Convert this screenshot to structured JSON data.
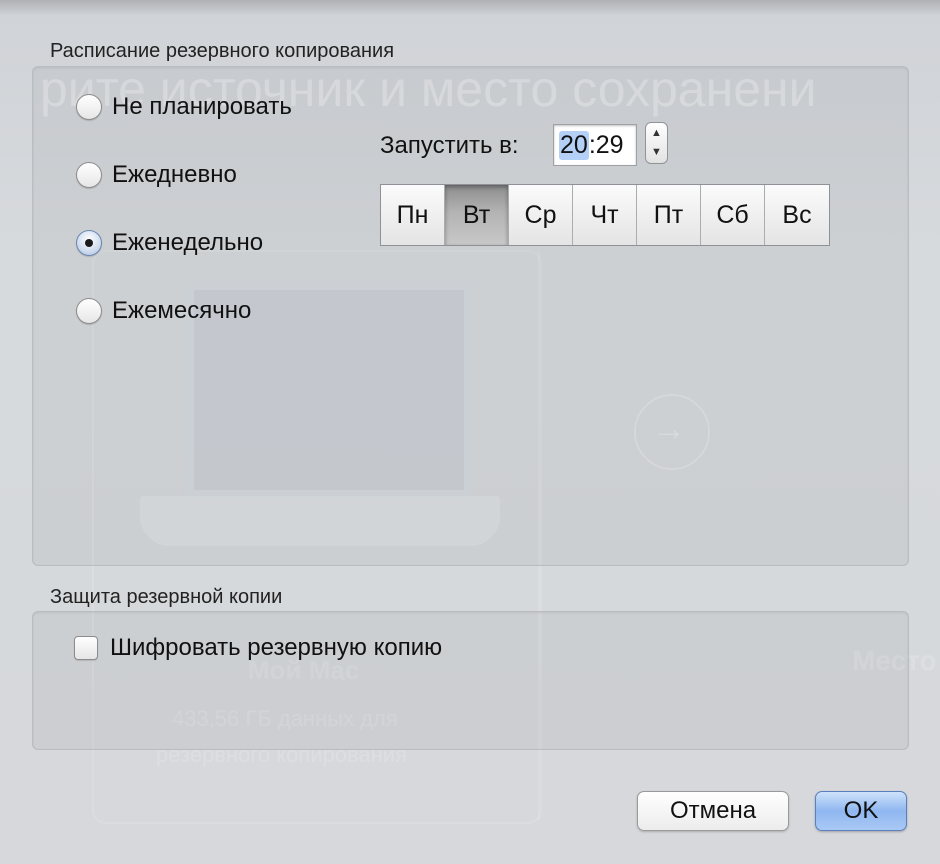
{
  "background": {
    "title": "рите источник и место сохранени",
    "overlay_1": "Мой Mac",
    "overlay_2": "433,56 ГБ данных для",
    "overlay_3": "резервного копирования",
    "overlay_4": "Место"
  },
  "schedule": {
    "title": "Расписание резервного копирования",
    "options": [
      {
        "label": "Не планировать",
        "checked": false
      },
      {
        "label": "Ежедневно",
        "checked": false
      },
      {
        "label": "Еженедельно",
        "checked": true
      },
      {
        "label": "Ежемесячно",
        "checked": false
      }
    ],
    "run_at_label": "Запустить в:",
    "time_hour": "20",
    "time_sep": ":",
    "time_minute": "29",
    "days": [
      {
        "label": "Пн",
        "selected": false
      },
      {
        "label": "Вт",
        "selected": true
      },
      {
        "label": "Ср",
        "selected": false
      },
      {
        "label": "Чт",
        "selected": false
      },
      {
        "label": "Пт",
        "selected": false
      },
      {
        "label": "Сб",
        "selected": false
      },
      {
        "label": "Вс",
        "selected": false
      }
    ]
  },
  "protection": {
    "title": "Защита резервной копии",
    "encrypt_label": "Шифровать резервную копию",
    "encrypt_checked": false
  },
  "buttons": {
    "cancel": "Отмена",
    "ok": "OK"
  },
  "icons": {
    "stepper_up": "▲",
    "stepper_down": "▼",
    "arrow": "→"
  },
  "colors": {
    "selection": "#b5d0f6",
    "default_button": "#8fb7f0"
  }
}
